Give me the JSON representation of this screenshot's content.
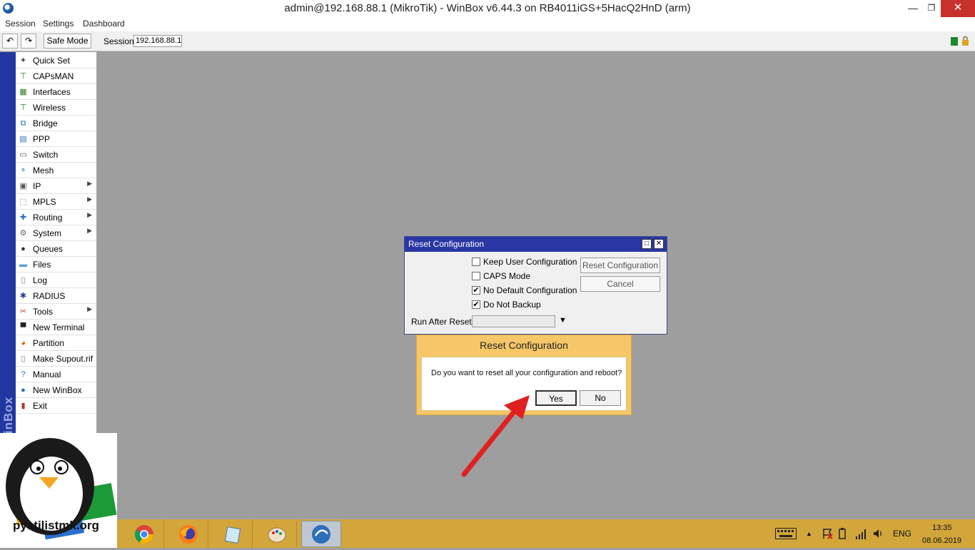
{
  "window": {
    "title": "admin@192.168.88.1 (MikroTik) - WinBox v6.44.3 on RB4011iGS+5HacQ2HnD (arm)",
    "min_glyph": "—",
    "max_glyph": "❐",
    "close_glyph": "✕"
  },
  "menu": [
    "Session",
    "Settings",
    "Dashboard"
  ],
  "toolbar": {
    "undo_glyph": "↶",
    "redo_glyph": "↷",
    "safe_mode": "Safe Mode",
    "session_label": "Session:",
    "session_value": "192.168.88.1"
  },
  "sidebar": {
    "brand": "inBox",
    "items": [
      {
        "label": "Quick Set",
        "icon": "magic-wand-icon",
        "glyph": "✦",
        "color": "#444",
        "submenu": false
      },
      {
        "label": "CAPsMAN",
        "icon": "antenna-icon",
        "glyph": "⊤",
        "color": "#2a7a2a",
        "submenu": false
      },
      {
        "label": "Interfaces",
        "icon": "interface-icon",
        "glyph": "▦",
        "color": "#2a7a2a",
        "submenu": false
      },
      {
        "label": "Wireless",
        "icon": "wireless-icon",
        "glyph": "⊤",
        "color": "#2a7a2a",
        "submenu": false
      },
      {
        "label": "Bridge",
        "icon": "bridge-icon",
        "glyph": "⧉",
        "color": "#2a6fba",
        "submenu": false
      },
      {
        "label": "PPP",
        "icon": "ppp-icon",
        "glyph": "▤",
        "color": "#2a6fba",
        "submenu": false
      },
      {
        "label": "Switch",
        "icon": "switch-icon",
        "glyph": "▭",
        "color": "#555",
        "submenu": false
      },
      {
        "label": "Mesh",
        "icon": "mesh-icon",
        "glyph": "⚬",
        "color": "#2a6fba",
        "submenu": false
      },
      {
        "label": "IP",
        "icon": "ip-icon",
        "glyph": "▣",
        "color": "#555",
        "submenu": true
      },
      {
        "label": "MPLS",
        "icon": "mpls-icon",
        "glyph": "⬚",
        "color": "#777",
        "submenu": true
      },
      {
        "label": "Routing",
        "icon": "routing-icon",
        "glyph": "✚",
        "color": "#2a6fba",
        "submenu": true
      },
      {
        "label": "System",
        "icon": "gear-icon",
        "glyph": "⚙",
        "color": "#666",
        "submenu": true
      },
      {
        "label": "Queues",
        "icon": "queues-icon",
        "glyph": "●",
        "color": "#333",
        "submenu": false
      },
      {
        "label": "Files",
        "icon": "folder-icon",
        "glyph": "▬",
        "color": "#5b9bd5",
        "submenu": false
      },
      {
        "label": "Log",
        "icon": "log-icon",
        "glyph": "▯",
        "color": "#777",
        "submenu": false
      },
      {
        "label": "RADIUS",
        "icon": "radius-icon",
        "glyph": "✱",
        "color": "#2a3aa0",
        "submenu": false
      },
      {
        "label": "Tools",
        "icon": "tools-icon",
        "glyph": "✂",
        "color": "#c0392b",
        "submenu": true
      },
      {
        "label": "New Terminal",
        "icon": "terminal-icon",
        "glyph": "▀",
        "color": "#222",
        "submenu": false
      },
      {
        "label": "Partition",
        "icon": "partition-icon",
        "glyph": "◕",
        "color": "#d35400",
        "submenu": false
      },
      {
        "label": "Make Supout.rif",
        "icon": "document-icon",
        "glyph": "▯",
        "color": "#777",
        "submenu": false
      },
      {
        "label": "Manual",
        "icon": "help-icon",
        "glyph": "?",
        "color": "#2a6fba",
        "submenu": false
      },
      {
        "label": "New WinBox",
        "icon": "winbox-icon",
        "glyph": "●",
        "color": "#2a6fba",
        "submenu": false
      },
      {
        "label": "Exit",
        "icon": "exit-icon",
        "glyph": "▮",
        "color": "#b03a2e",
        "submenu": false
      }
    ],
    "submenu_glyph": "▶"
  },
  "logo": {
    "text": "pyatilistmk.org"
  },
  "reset_dialog": {
    "title": "Reset Configuration",
    "options": [
      {
        "label": "Keep User Configuration",
        "checked": false
      },
      {
        "label": "CAPS Mode",
        "checked": false
      },
      {
        "label": "No Default Configuration",
        "checked": true
      },
      {
        "label": "Do Not Backup",
        "checked": true
      }
    ],
    "check_glyph": "✔",
    "reset_button": "Reset Configuration",
    "cancel_button": "Cancel",
    "run_after_reset_label": "Run After Reset:",
    "run_after_reset_value": "",
    "dropdown_glyph": "▼",
    "restore_glyph": "□",
    "close_glyph": "✕"
  },
  "confirm": {
    "title": "Reset Configuration",
    "message": "Do you want to reset all your configuration and reboot?",
    "yes": "Yes",
    "no": "No"
  },
  "taskbar": {
    "tray_up_glyph": "▲",
    "language": "ENG",
    "time": "13:35",
    "date": "08.06.2019"
  },
  "colors": {
    "sidebar_strip": "#2137a0",
    "dialog_title": "#2a36a3",
    "confirm_bg": "#f5c768",
    "taskbar": "#d2a63a",
    "arrow": "#e02020"
  }
}
